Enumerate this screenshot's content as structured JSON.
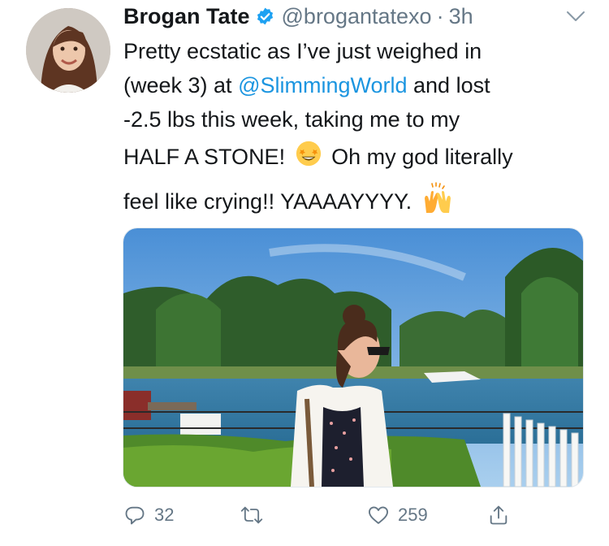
{
  "tweet": {
    "author": {
      "name": "Brogan Tate",
      "handle": "@brogantatexo",
      "time": "3h",
      "separator": "·"
    },
    "text": {
      "line1": "Pretty ecstatic as I’ve just weighed in",
      "line2_before": "(week 3) at ",
      "mention": "@SlimmingWorld",
      "line2_after": " and lost",
      "line3": "-2.5 lbs this week, taking me to my",
      "line4_before": "HALF A STONE! ",
      "line4_after": " Oh my god literally",
      "line5": "feel like crying!! YAAAAYYYY. "
    },
    "emoji": [
      "star-struck-emoji",
      "raising-hands-emoji"
    ],
    "photo": {
      "description_icon": "photo-of-woman-by-river"
    },
    "counts": {
      "replies": "32",
      "retweets": "",
      "likes": "259"
    },
    "icons": [
      "verified-icon",
      "chevron-down-icon",
      "reply-icon",
      "retweet-icon",
      "like-icon",
      "share-icon"
    ],
    "colors": {
      "mention": "#1b95e0",
      "verified": "#1da1f2",
      "muted": "#657786"
    }
  }
}
